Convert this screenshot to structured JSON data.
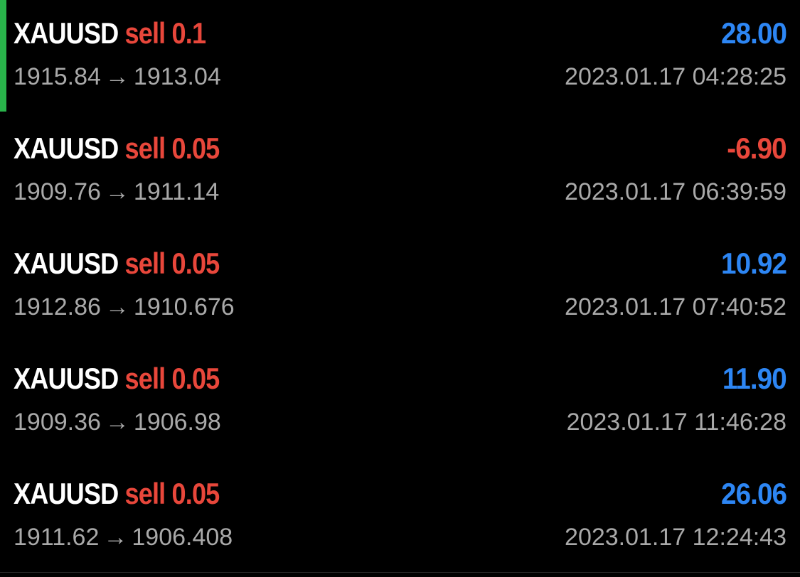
{
  "arrow_glyph": "→",
  "trades": [
    {
      "symbol": "XAUUSD",
      "side": "sell",
      "volume": "0.1",
      "profit": "28.00",
      "profit_sign": "positive",
      "open_price": "1915.84",
      "close_price": "1913.04",
      "time": "2023.01.17 04:28:25",
      "selected": true
    },
    {
      "symbol": "XAUUSD",
      "side": "sell",
      "volume": "0.05",
      "profit": "-6.90",
      "profit_sign": "negative",
      "open_price": "1909.76",
      "close_price": "1911.14",
      "time": "2023.01.17 06:39:59",
      "selected": false
    },
    {
      "symbol": "XAUUSD",
      "side": "sell",
      "volume": "0.05",
      "profit": "10.92",
      "profit_sign": "positive",
      "open_price": "1912.86",
      "close_price": "1910.676",
      "time": "2023.01.17 07:40:52",
      "selected": false
    },
    {
      "symbol": "XAUUSD",
      "side": "sell",
      "volume": "0.05",
      "profit": "11.90",
      "profit_sign": "positive",
      "open_price": "1909.36",
      "close_price": "1906.98",
      "time": "2023.01.17 11:46:28",
      "selected": false
    },
    {
      "symbol": "XAUUSD",
      "side": "sell",
      "volume": "0.05",
      "profit": "26.06",
      "profit_sign": "positive",
      "open_price": "1911.62",
      "close_price": "1906.408",
      "time": "2023.01.17 12:24:43",
      "selected": false
    }
  ],
  "colors": {
    "background": "#000000",
    "symbol": "#ffffff",
    "sell": "#e8473b",
    "profit_positive": "#2d86f4",
    "profit_negative": "#e8473b",
    "secondary_text": "#a9a9a9",
    "selection_indicator": "#29b34a"
  }
}
